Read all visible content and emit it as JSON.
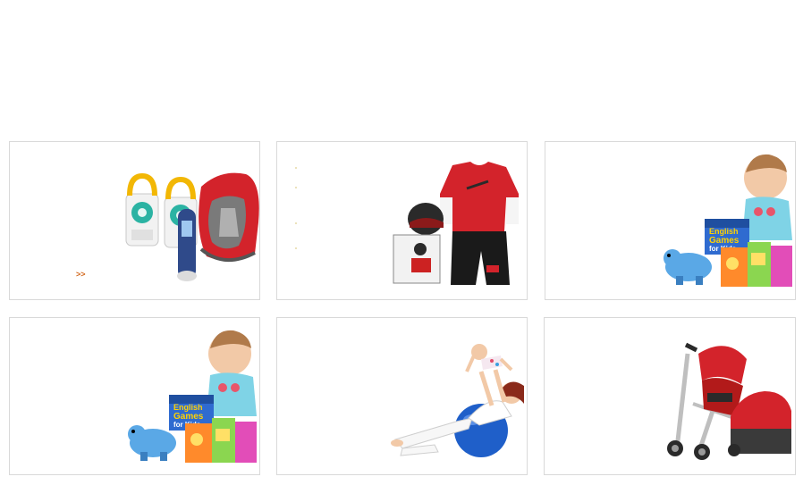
{
  "cards": [
    {
      "name": "baby-monitor-car-seat",
      "link_text": ">>"
    },
    {
      "name": "kids-clothing"
    },
    {
      "name": "baby-learning-toys"
    },
    {
      "name": "baby-learning-toys-2"
    },
    {
      "name": "mother-baby-exercise"
    },
    {
      "name": "baby-stroller"
    }
  ],
  "book_text": {
    "line1": "English",
    "line2": "Games",
    "line3": "for Kids"
  },
  "colors": {
    "border": "#d9d9d9",
    "link": "#d2691e",
    "accent_red": "#d3232b"
  }
}
